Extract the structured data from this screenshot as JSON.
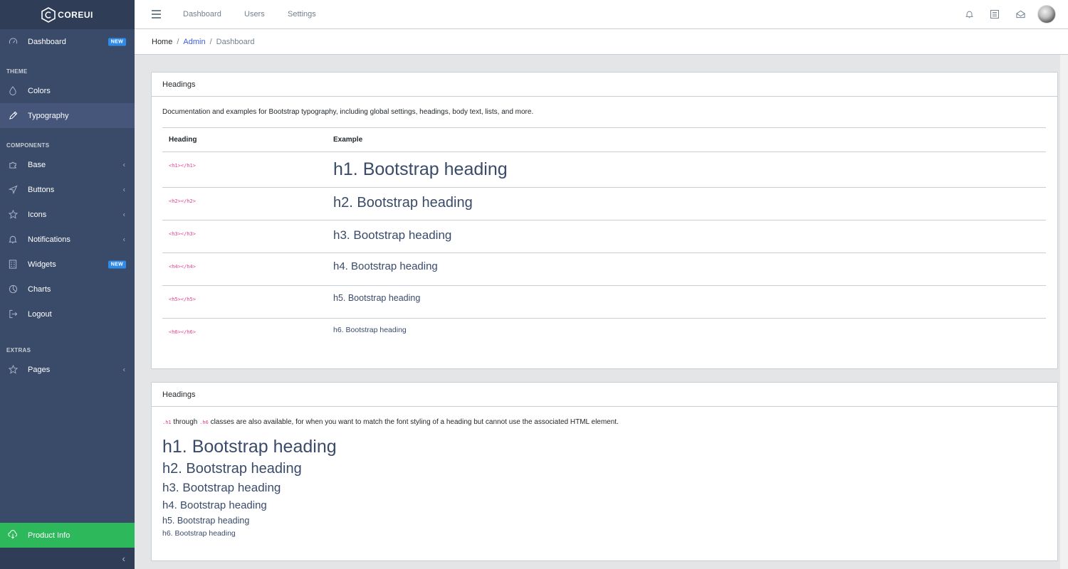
{
  "brand": {
    "name": "COREUI"
  },
  "sidebar": {
    "items": [
      {
        "label": "Dashboard",
        "badge": "NEW",
        "icon": "speedometer-icon"
      },
      {
        "title": "THEME"
      },
      {
        "label": "Colors",
        "icon": "drop-icon"
      },
      {
        "label": "Typography",
        "icon": "pencil-icon"
      },
      {
        "title": "COMPONENTS"
      },
      {
        "label": "Base",
        "icon": "puzzle-icon",
        "chevron": "‹"
      },
      {
        "label": "Buttons",
        "icon": "cursor-icon",
        "chevron": "‹"
      },
      {
        "label": "Icons",
        "icon": "star-icon",
        "chevron": "‹"
      },
      {
        "label": "Notifications",
        "icon": "bell-icon",
        "chevron": "‹"
      },
      {
        "label": "Widgets",
        "badge": "NEW",
        "icon": "calculator-icon"
      },
      {
        "label": "Charts",
        "icon": "pie-chart-icon"
      },
      {
        "label": "Logout",
        "icon": "logout-icon"
      },
      {
        "title": "EXTRAS"
      },
      {
        "label": "Pages",
        "icon": "star-icon",
        "chevron": "‹"
      }
    ],
    "footer": {
      "label": "Product Info",
      "icon": "cloud-download-icon"
    },
    "minimizer": "‹"
  },
  "header": {
    "nav": [
      "Dashboard",
      "Users",
      "Settings"
    ]
  },
  "breadcrumb": {
    "home": "Home",
    "sep": "/",
    "admin": "Admin",
    "current": "Dashboard"
  },
  "card1": {
    "title": "Headings",
    "description": "Documentation and examples for Bootstrap typography, including global settings, headings, body text, lists, and more.",
    "columns": [
      "Heading",
      "Example"
    ],
    "rows": [
      {
        "tag": "<h1></h1>",
        "example": "h1. Bootstrap heading"
      },
      {
        "tag": "<h2></h2>",
        "example": "h2. Bootstrap heading"
      },
      {
        "tag": "<h3></h3>",
        "example": "h3. Bootstrap heading"
      },
      {
        "tag": "<h4></h4>",
        "example": "h4. Bootstrap heading"
      },
      {
        "tag": "<h5></h5>",
        "example": "h5. Bootstrap heading"
      },
      {
        "tag": "<h6></h6>",
        "example": "h6. Bootstrap heading"
      }
    ]
  },
  "card2": {
    "title": "Headings",
    "code1": ".h1",
    "text1": " through ",
    "code2": ".h6",
    "text2": " classes are also available, for when you want to match the font styling of a heading but cannot use the associated HTML element.",
    "headings": [
      "h1. Bootstrap heading",
      "h2. Bootstrap heading",
      "h3. Bootstrap heading",
      "h4. Bootstrap heading",
      "h5. Bootstrap heading",
      "h6. Bootstrap heading"
    ]
  }
}
